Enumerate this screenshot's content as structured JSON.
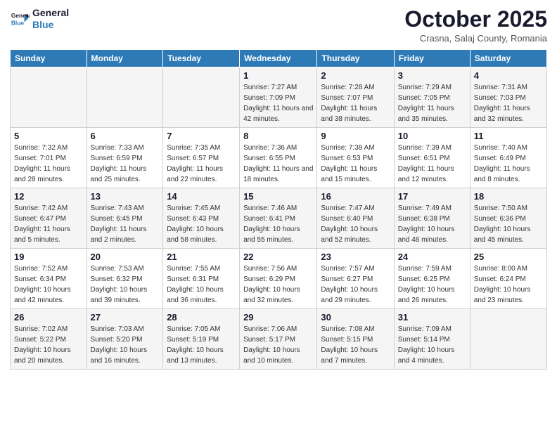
{
  "header": {
    "logo_line1": "General",
    "logo_line2": "Blue",
    "title": "October 2025",
    "subtitle": "Crasna, Salaj County, Romania"
  },
  "days_of_week": [
    "Sunday",
    "Monday",
    "Tuesday",
    "Wednesday",
    "Thursday",
    "Friday",
    "Saturday"
  ],
  "weeks": [
    [
      {
        "day": "",
        "sunrise": "",
        "sunset": "",
        "daylight": ""
      },
      {
        "day": "",
        "sunrise": "",
        "sunset": "",
        "daylight": ""
      },
      {
        "day": "",
        "sunrise": "",
        "sunset": "",
        "daylight": ""
      },
      {
        "day": "1",
        "sunrise": "Sunrise: 7:27 AM",
        "sunset": "Sunset: 7:09 PM",
        "daylight": "Daylight: 11 hours and 42 minutes."
      },
      {
        "day": "2",
        "sunrise": "Sunrise: 7:28 AM",
        "sunset": "Sunset: 7:07 PM",
        "daylight": "Daylight: 11 hours and 38 minutes."
      },
      {
        "day": "3",
        "sunrise": "Sunrise: 7:29 AM",
        "sunset": "Sunset: 7:05 PM",
        "daylight": "Daylight: 11 hours and 35 minutes."
      },
      {
        "day": "4",
        "sunrise": "Sunrise: 7:31 AM",
        "sunset": "Sunset: 7:03 PM",
        "daylight": "Daylight: 11 hours and 32 minutes."
      }
    ],
    [
      {
        "day": "5",
        "sunrise": "Sunrise: 7:32 AM",
        "sunset": "Sunset: 7:01 PM",
        "daylight": "Daylight: 11 hours and 28 minutes."
      },
      {
        "day": "6",
        "sunrise": "Sunrise: 7:33 AM",
        "sunset": "Sunset: 6:59 PM",
        "daylight": "Daylight: 11 hours and 25 minutes."
      },
      {
        "day": "7",
        "sunrise": "Sunrise: 7:35 AM",
        "sunset": "Sunset: 6:57 PM",
        "daylight": "Daylight: 11 hours and 22 minutes."
      },
      {
        "day": "8",
        "sunrise": "Sunrise: 7:36 AM",
        "sunset": "Sunset: 6:55 PM",
        "daylight": "Daylight: 11 hours and 18 minutes."
      },
      {
        "day": "9",
        "sunrise": "Sunrise: 7:38 AM",
        "sunset": "Sunset: 6:53 PM",
        "daylight": "Daylight: 11 hours and 15 minutes."
      },
      {
        "day": "10",
        "sunrise": "Sunrise: 7:39 AM",
        "sunset": "Sunset: 6:51 PM",
        "daylight": "Daylight: 11 hours and 12 minutes."
      },
      {
        "day": "11",
        "sunrise": "Sunrise: 7:40 AM",
        "sunset": "Sunset: 6:49 PM",
        "daylight": "Daylight: 11 hours and 8 minutes."
      }
    ],
    [
      {
        "day": "12",
        "sunrise": "Sunrise: 7:42 AM",
        "sunset": "Sunset: 6:47 PM",
        "daylight": "Daylight: 11 hours and 5 minutes."
      },
      {
        "day": "13",
        "sunrise": "Sunrise: 7:43 AM",
        "sunset": "Sunset: 6:45 PM",
        "daylight": "Daylight: 11 hours and 2 minutes."
      },
      {
        "day": "14",
        "sunrise": "Sunrise: 7:45 AM",
        "sunset": "Sunset: 6:43 PM",
        "daylight": "Daylight: 10 hours and 58 minutes."
      },
      {
        "day": "15",
        "sunrise": "Sunrise: 7:46 AM",
        "sunset": "Sunset: 6:41 PM",
        "daylight": "Daylight: 10 hours and 55 minutes."
      },
      {
        "day": "16",
        "sunrise": "Sunrise: 7:47 AM",
        "sunset": "Sunset: 6:40 PM",
        "daylight": "Daylight: 10 hours and 52 minutes."
      },
      {
        "day": "17",
        "sunrise": "Sunrise: 7:49 AM",
        "sunset": "Sunset: 6:38 PM",
        "daylight": "Daylight: 10 hours and 48 minutes."
      },
      {
        "day": "18",
        "sunrise": "Sunrise: 7:50 AM",
        "sunset": "Sunset: 6:36 PM",
        "daylight": "Daylight: 10 hours and 45 minutes."
      }
    ],
    [
      {
        "day": "19",
        "sunrise": "Sunrise: 7:52 AM",
        "sunset": "Sunset: 6:34 PM",
        "daylight": "Daylight: 10 hours and 42 minutes."
      },
      {
        "day": "20",
        "sunrise": "Sunrise: 7:53 AM",
        "sunset": "Sunset: 6:32 PM",
        "daylight": "Daylight: 10 hours and 39 minutes."
      },
      {
        "day": "21",
        "sunrise": "Sunrise: 7:55 AM",
        "sunset": "Sunset: 6:31 PM",
        "daylight": "Daylight: 10 hours and 36 minutes."
      },
      {
        "day": "22",
        "sunrise": "Sunrise: 7:56 AM",
        "sunset": "Sunset: 6:29 PM",
        "daylight": "Daylight: 10 hours and 32 minutes."
      },
      {
        "day": "23",
        "sunrise": "Sunrise: 7:57 AM",
        "sunset": "Sunset: 6:27 PM",
        "daylight": "Daylight: 10 hours and 29 minutes."
      },
      {
        "day": "24",
        "sunrise": "Sunrise: 7:59 AM",
        "sunset": "Sunset: 6:25 PM",
        "daylight": "Daylight: 10 hours and 26 minutes."
      },
      {
        "day": "25",
        "sunrise": "Sunrise: 8:00 AM",
        "sunset": "Sunset: 6:24 PM",
        "daylight": "Daylight: 10 hours and 23 minutes."
      }
    ],
    [
      {
        "day": "26",
        "sunrise": "Sunrise: 7:02 AM",
        "sunset": "Sunset: 5:22 PM",
        "daylight": "Daylight: 10 hours and 20 minutes."
      },
      {
        "day": "27",
        "sunrise": "Sunrise: 7:03 AM",
        "sunset": "Sunset: 5:20 PM",
        "daylight": "Daylight: 10 hours and 16 minutes."
      },
      {
        "day": "28",
        "sunrise": "Sunrise: 7:05 AM",
        "sunset": "Sunset: 5:19 PM",
        "daylight": "Daylight: 10 hours and 13 minutes."
      },
      {
        "day": "29",
        "sunrise": "Sunrise: 7:06 AM",
        "sunset": "Sunset: 5:17 PM",
        "daylight": "Daylight: 10 hours and 10 minutes."
      },
      {
        "day": "30",
        "sunrise": "Sunrise: 7:08 AM",
        "sunset": "Sunset: 5:15 PM",
        "daylight": "Daylight: 10 hours and 7 minutes."
      },
      {
        "day": "31",
        "sunrise": "Sunrise: 7:09 AM",
        "sunset": "Sunset: 5:14 PM",
        "daylight": "Daylight: 10 hours and 4 minutes."
      },
      {
        "day": "",
        "sunrise": "",
        "sunset": "",
        "daylight": ""
      }
    ]
  ]
}
